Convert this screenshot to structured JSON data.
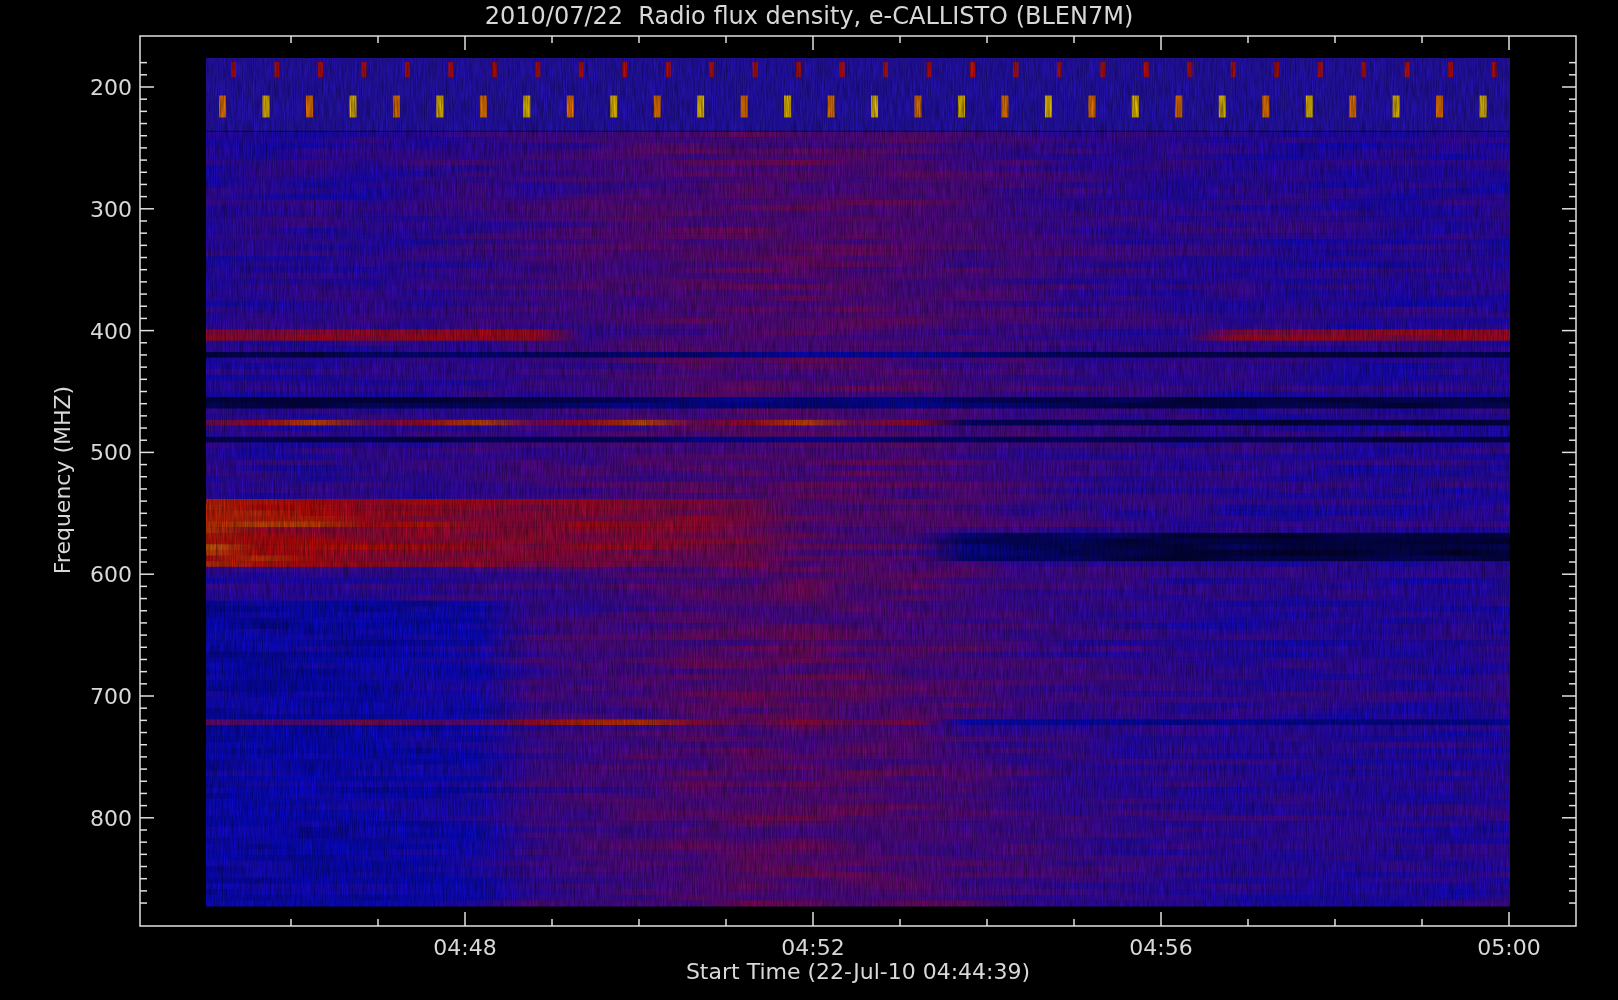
{
  "title": "2010/07/22  Radio flux density, e-CALLISTO (BLEN7M)",
  "y_axis": {
    "label": "Frequency (MHZ)",
    "ticks": [
      "200",
      "300",
      "400",
      "500",
      "600",
      "700",
      "800"
    ]
  },
  "x_axis": {
    "label": "Start Time (22-Jul-10 04:44:39)",
    "ticks": [
      "04:48",
      "04:52",
      "04:56",
      "05:00"
    ]
  }
}
